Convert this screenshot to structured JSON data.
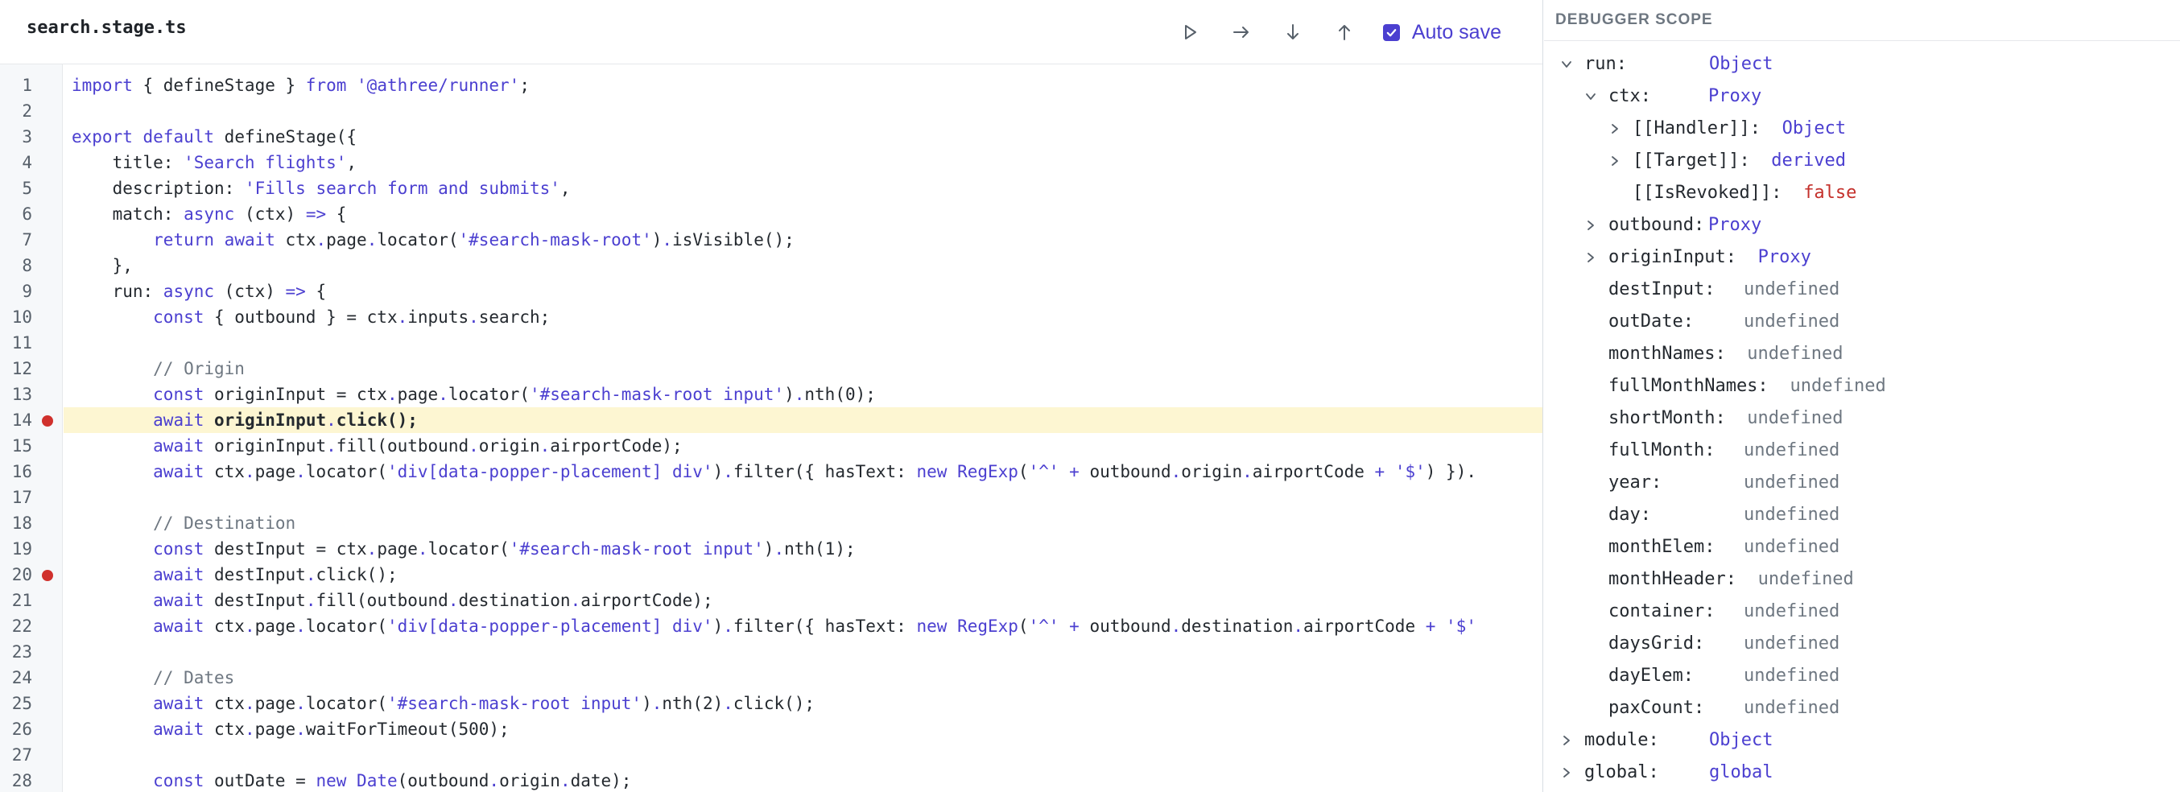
{
  "tab": {
    "filename": "search.stage.ts"
  },
  "toolbar": {
    "buttons": [
      {
        "icon": "play-icon",
        "label": "run"
      },
      {
        "icon": "step-over-icon",
        "label": "step over"
      },
      {
        "icon": "step-into-icon",
        "label": "step into"
      },
      {
        "icon": "step-out-icon",
        "label": "step out"
      }
    ],
    "autosave": {
      "label": "Auto save",
      "checked": true
    }
  },
  "colors": {
    "accent": "#4b3fd0",
    "highlight_line": "#fdf6d2",
    "breakpoint": "#d0312d",
    "false_value": "#c4302b"
  },
  "editor": {
    "current_line": 14,
    "breakpoints": [
      14,
      20
    ],
    "lines": [
      [
        {
          "t": "import",
          "k": "kw"
        },
        {
          "t": " { defineStage } "
        },
        {
          "t": "from",
          "k": "kw"
        },
        {
          "t": " "
        },
        {
          "t": "'@athree/runner'",
          "k": "str"
        },
        {
          "t": ";"
        }
      ],
      [],
      [
        {
          "t": "export",
          "k": "kw"
        },
        {
          "t": " "
        },
        {
          "t": "default",
          "k": "kw"
        },
        {
          "t": " defineStage({"
        }
      ],
      [
        {
          "t": "    title: "
        },
        {
          "t": "'Search flights'",
          "k": "str"
        },
        {
          "t": ","
        }
      ],
      [
        {
          "t": "    description: "
        },
        {
          "t": "'Fills search form and submits'",
          "k": "str"
        },
        {
          "t": ","
        }
      ],
      [
        {
          "t": "    match: "
        },
        {
          "t": "async",
          "k": "kw"
        },
        {
          "t": " (ctx) "
        },
        {
          "t": "=>",
          "k": "kw"
        },
        {
          "t": " {"
        }
      ],
      [
        {
          "t": "        "
        },
        {
          "t": "return",
          "k": "kw"
        },
        {
          "t": " "
        },
        {
          "t": "await",
          "k": "kw"
        },
        {
          "t": " ctx"
        },
        {
          "t": ".",
          "k": "kw"
        },
        {
          "t": "page"
        },
        {
          "t": ".",
          "k": "kw"
        },
        {
          "t": "locator("
        },
        {
          "t": "'#search-mask-root'",
          "k": "str"
        },
        {
          "t": ")"
        },
        {
          "t": ".",
          "k": "kw"
        },
        {
          "t": "isVisible();"
        }
      ],
      [
        {
          "t": "    },"
        }
      ],
      [
        {
          "t": "    run: "
        },
        {
          "t": "async",
          "k": "kw"
        },
        {
          "t": " (ctx) "
        },
        {
          "t": "=>",
          "k": "kw"
        },
        {
          "t": " {"
        }
      ],
      [
        {
          "t": "        "
        },
        {
          "t": "const",
          "k": "kw"
        },
        {
          "t": " { outbound } = ctx"
        },
        {
          "t": ".",
          "k": "kw"
        },
        {
          "t": "inputs"
        },
        {
          "t": ".",
          "k": "kw"
        },
        {
          "t": "search;"
        }
      ],
      [],
      [
        {
          "t": "        // Origin",
          "k": "com"
        }
      ],
      [
        {
          "t": "        "
        },
        {
          "t": "const",
          "k": "kw"
        },
        {
          "t": " originInput = ctx"
        },
        {
          "t": ".",
          "k": "kw"
        },
        {
          "t": "page"
        },
        {
          "t": ".",
          "k": "kw"
        },
        {
          "t": "locator("
        },
        {
          "t": "'#search-mask-root input'",
          "k": "str"
        },
        {
          "t": ")"
        },
        {
          "t": ".",
          "k": "kw"
        },
        {
          "t": "nth(0);"
        }
      ],
      [
        {
          "t": "        "
        },
        {
          "t": "await",
          "k": "kw"
        },
        {
          "t": " "
        },
        {
          "t": "originInput",
          "k": "b"
        },
        {
          "t": ".",
          "k": "kw"
        },
        {
          "t": "click();",
          "k": "b"
        }
      ],
      [
        {
          "t": "        "
        },
        {
          "t": "await",
          "k": "kw"
        },
        {
          "t": " originInput"
        },
        {
          "t": ".",
          "k": "kw"
        },
        {
          "t": "fill(outbound"
        },
        {
          "t": ".",
          "k": "kw"
        },
        {
          "t": "origin"
        },
        {
          "t": ".",
          "k": "kw"
        },
        {
          "t": "airportCode);"
        }
      ],
      [
        {
          "t": "        "
        },
        {
          "t": "await",
          "k": "kw"
        },
        {
          "t": " ctx"
        },
        {
          "t": ".",
          "k": "kw"
        },
        {
          "t": "page"
        },
        {
          "t": ".",
          "k": "kw"
        },
        {
          "t": "locator("
        },
        {
          "t": "'div[data-popper-placement] div'",
          "k": "str"
        },
        {
          "t": ")"
        },
        {
          "t": ".",
          "k": "kw"
        },
        {
          "t": "filter({ hasText: "
        },
        {
          "t": "new",
          "k": "kw"
        },
        {
          "t": " "
        },
        {
          "t": "RegExp",
          "k": "kw"
        },
        {
          "t": "("
        },
        {
          "t": "'^'",
          "k": "str"
        },
        {
          "t": " "
        },
        {
          "t": "+",
          "k": "kw"
        },
        {
          "t": " outbound"
        },
        {
          "t": ".",
          "k": "kw"
        },
        {
          "t": "origin"
        },
        {
          "t": ".",
          "k": "kw"
        },
        {
          "t": "airportCode "
        },
        {
          "t": "+",
          "k": "kw"
        },
        {
          "t": " "
        },
        {
          "t": "'$'",
          "k": "str"
        },
        {
          "t": ") })."
        }
      ],
      [],
      [
        {
          "t": "        // Destination",
          "k": "com"
        }
      ],
      [
        {
          "t": "        "
        },
        {
          "t": "const",
          "k": "kw"
        },
        {
          "t": " destInput = ctx"
        },
        {
          "t": ".",
          "k": "kw"
        },
        {
          "t": "page"
        },
        {
          "t": ".",
          "k": "kw"
        },
        {
          "t": "locator("
        },
        {
          "t": "'#search-mask-root input'",
          "k": "str"
        },
        {
          "t": ")"
        },
        {
          "t": ".",
          "k": "kw"
        },
        {
          "t": "nth(1);"
        }
      ],
      [
        {
          "t": "        "
        },
        {
          "t": "await",
          "k": "kw"
        },
        {
          "t": " destInput"
        },
        {
          "t": ".",
          "k": "kw"
        },
        {
          "t": "click();"
        }
      ],
      [
        {
          "t": "        "
        },
        {
          "t": "await",
          "k": "kw"
        },
        {
          "t": " destInput"
        },
        {
          "t": ".",
          "k": "kw"
        },
        {
          "t": "fill(outbound"
        },
        {
          "t": ".",
          "k": "kw"
        },
        {
          "t": "destination"
        },
        {
          "t": ".",
          "k": "kw"
        },
        {
          "t": "airportCode);"
        }
      ],
      [
        {
          "t": "        "
        },
        {
          "t": "await",
          "k": "kw"
        },
        {
          "t": " ctx"
        },
        {
          "t": ".",
          "k": "kw"
        },
        {
          "t": "page"
        },
        {
          "t": ".",
          "k": "kw"
        },
        {
          "t": "locator("
        },
        {
          "t": "'div[data-popper-placement] div'",
          "k": "str"
        },
        {
          "t": ")"
        },
        {
          "t": ".",
          "k": "kw"
        },
        {
          "t": "filter({ hasText: "
        },
        {
          "t": "new",
          "k": "kw"
        },
        {
          "t": " "
        },
        {
          "t": "RegExp",
          "k": "kw"
        },
        {
          "t": "("
        },
        {
          "t": "'^'",
          "k": "str"
        },
        {
          "t": " "
        },
        {
          "t": "+",
          "k": "kw"
        },
        {
          "t": " outbound"
        },
        {
          "t": ".",
          "k": "kw"
        },
        {
          "t": "destination"
        },
        {
          "t": ".",
          "k": "kw"
        },
        {
          "t": "airportCode "
        },
        {
          "t": "+",
          "k": "kw"
        },
        {
          "t": " "
        },
        {
          "t": "'$'",
          "k": "str"
        }
      ],
      [],
      [
        {
          "t": "        // Dates",
          "k": "com"
        }
      ],
      [
        {
          "t": "        "
        },
        {
          "t": "await",
          "k": "kw"
        },
        {
          "t": " ctx"
        },
        {
          "t": ".",
          "k": "kw"
        },
        {
          "t": "page"
        },
        {
          "t": ".",
          "k": "kw"
        },
        {
          "t": "locator("
        },
        {
          "t": "'#search-mask-root input'",
          "k": "str"
        },
        {
          "t": ")"
        },
        {
          "t": ".",
          "k": "kw"
        },
        {
          "t": "nth(2)"
        },
        {
          "t": ".",
          "k": "kw"
        },
        {
          "t": "click();"
        }
      ],
      [
        {
          "t": "        "
        },
        {
          "t": "await",
          "k": "kw"
        },
        {
          "t": " ctx"
        },
        {
          "t": ".",
          "k": "kw"
        },
        {
          "t": "page"
        },
        {
          "t": ".",
          "k": "kw"
        },
        {
          "t": "waitForTimeout(500);"
        }
      ],
      [],
      [
        {
          "t": "        "
        },
        {
          "t": "const",
          "k": "kw"
        },
        {
          "t": " outDate = "
        },
        {
          "t": "new",
          "k": "kw"
        },
        {
          "t": " "
        },
        {
          "t": "Date",
          "k": "kw"
        },
        {
          "t": "(outbound"
        },
        {
          "t": ".",
          "k": "kw"
        },
        {
          "t": "origin"
        },
        {
          "t": ".",
          "k": "kw"
        },
        {
          "t": "date);"
        }
      ]
    ]
  },
  "scope": {
    "header": "DEBUGGER SCOPE",
    "items": [
      {
        "depth": 0,
        "expander": "open",
        "key": "run:",
        "value": "Object",
        "vtype": "obj"
      },
      {
        "depth": 1,
        "expander": "open",
        "key": "ctx:",
        "value": "Proxy",
        "vtype": "obj"
      },
      {
        "depth": 2,
        "expander": "closed",
        "key": "[[Handler]]:",
        "value": "Object",
        "vtype": "obj"
      },
      {
        "depth": 2,
        "expander": "closed",
        "key": "[[Target]]:",
        "value": "derived",
        "vtype": "obj"
      },
      {
        "depth": 2,
        "expander": "none",
        "key": "[[IsRevoked]]:",
        "value": "false",
        "vtype": "false"
      },
      {
        "depth": 1,
        "expander": "closed",
        "key": "outbound:",
        "value": "Proxy",
        "vtype": "obj"
      },
      {
        "depth": 1,
        "expander": "closed",
        "key": "originInput:",
        "value": "Proxy",
        "vtype": "obj"
      },
      {
        "depth": 1,
        "expander": "none",
        "key": "destInput:",
        "value": "undefined",
        "vtype": "und"
      },
      {
        "depth": 1,
        "expander": "none",
        "key": "outDate:",
        "value": "undefined",
        "vtype": "und"
      },
      {
        "depth": 1,
        "expander": "none",
        "key": "monthNames:",
        "value": "undefined",
        "vtype": "und"
      },
      {
        "depth": 1,
        "expander": "none",
        "key": "fullMonthNames:",
        "value": "undefined",
        "vtype": "und"
      },
      {
        "depth": 1,
        "expander": "none",
        "key": "shortMonth:",
        "value": "undefined",
        "vtype": "und"
      },
      {
        "depth": 1,
        "expander": "none",
        "key": "fullMonth:",
        "value": "undefined",
        "vtype": "und"
      },
      {
        "depth": 1,
        "expander": "none",
        "key": "year:",
        "value": "undefined",
        "vtype": "und"
      },
      {
        "depth": 1,
        "expander": "none",
        "key": "day:",
        "value": "undefined",
        "vtype": "und"
      },
      {
        "depth": 1,
        "expander": "none",
        "key": "monthElem:",
        "value": "undefined",
        "vtype": "und"
      },
      {
        "depth": 1,
        "expander": "none",
        "key": "monthHeader:",
        "value": "undefined",
        "vtype": "und"
      },
      {
        "depth": 1,
        "expander": "none",
        "key": "container:",
        "value": "undefined",
        "vtype": "und"
      },
      {
        "depth": 1,
        "expander": "none",
        "key": "daysGrid:",
        "value": "undefined",
        "vtype": "und"
      },
      {
        "depth": 1,
        "expander": "none",
        "key": "dayElem:",
        "value": "undefined",
        "vtype": "und"
      },
      {
        "depth": 1,
        "expander": "none",
        "key": "paxCount:",
        "value": "undefined",
        "vtype": "und"
      },
      {
        "depth": 0,
        "expander": "closed",
        "key": "module:",
        "value": "Object",
        "vtype": "obj"
      },
      {
        "depth": 0,
        "expander": "closed",
        "key": "global:",
        "value": "global",
        "vtype": "obj"
      }
    ]
  }
}
